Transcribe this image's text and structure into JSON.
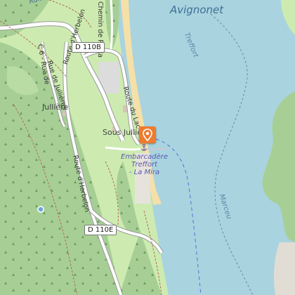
{
  "map": {
    "lake_labels": {
      "main": "Avignonet",
      "treffort": "Treffort",
      "marceu": "Marceu"
    },
    "top_cut_label": "Ruisseau de Pabla",
    "road_labels": {
      "chemin_pabla": "Chemin de Pabla",
      "rue_jullieres_short": "C 6 - Rue de",
      "rue_jullieres": "Rue de Jullières",
      "route_herbelon_north": "Route d'Herbelon",
      "route_herbelon_south": "Route d'Herbelon",
      "route_du_lac": "Route du Lac"
    },
    "shields": {
      "d110b": "D 110B",
      "d110e": "D 110E"
    },
    "places": {
      "julliere": "Jullière",
      "sous_jullieres": "Sous Jullières"
    },
    "ferry_stop": {
      "line1": "Embarcadère",
      "line2": "Treffort",
      "line3": "- La Mira"
    },
    "icons": [
      "location-pin-icon",
      "anchor-icon",
      "viewpoint-icon"
    ],
    "colors": {
      "water": "#a9d3df",
      "forest": "#a7cf95",
      "meadow": "#cdebb0",
      "beach": "#f5e0a8",
      "road_major": "#ffffff",
      "ferry_route": "#5b6fd6",
      "marker": "#ef7b2f"
    }
  }
}
